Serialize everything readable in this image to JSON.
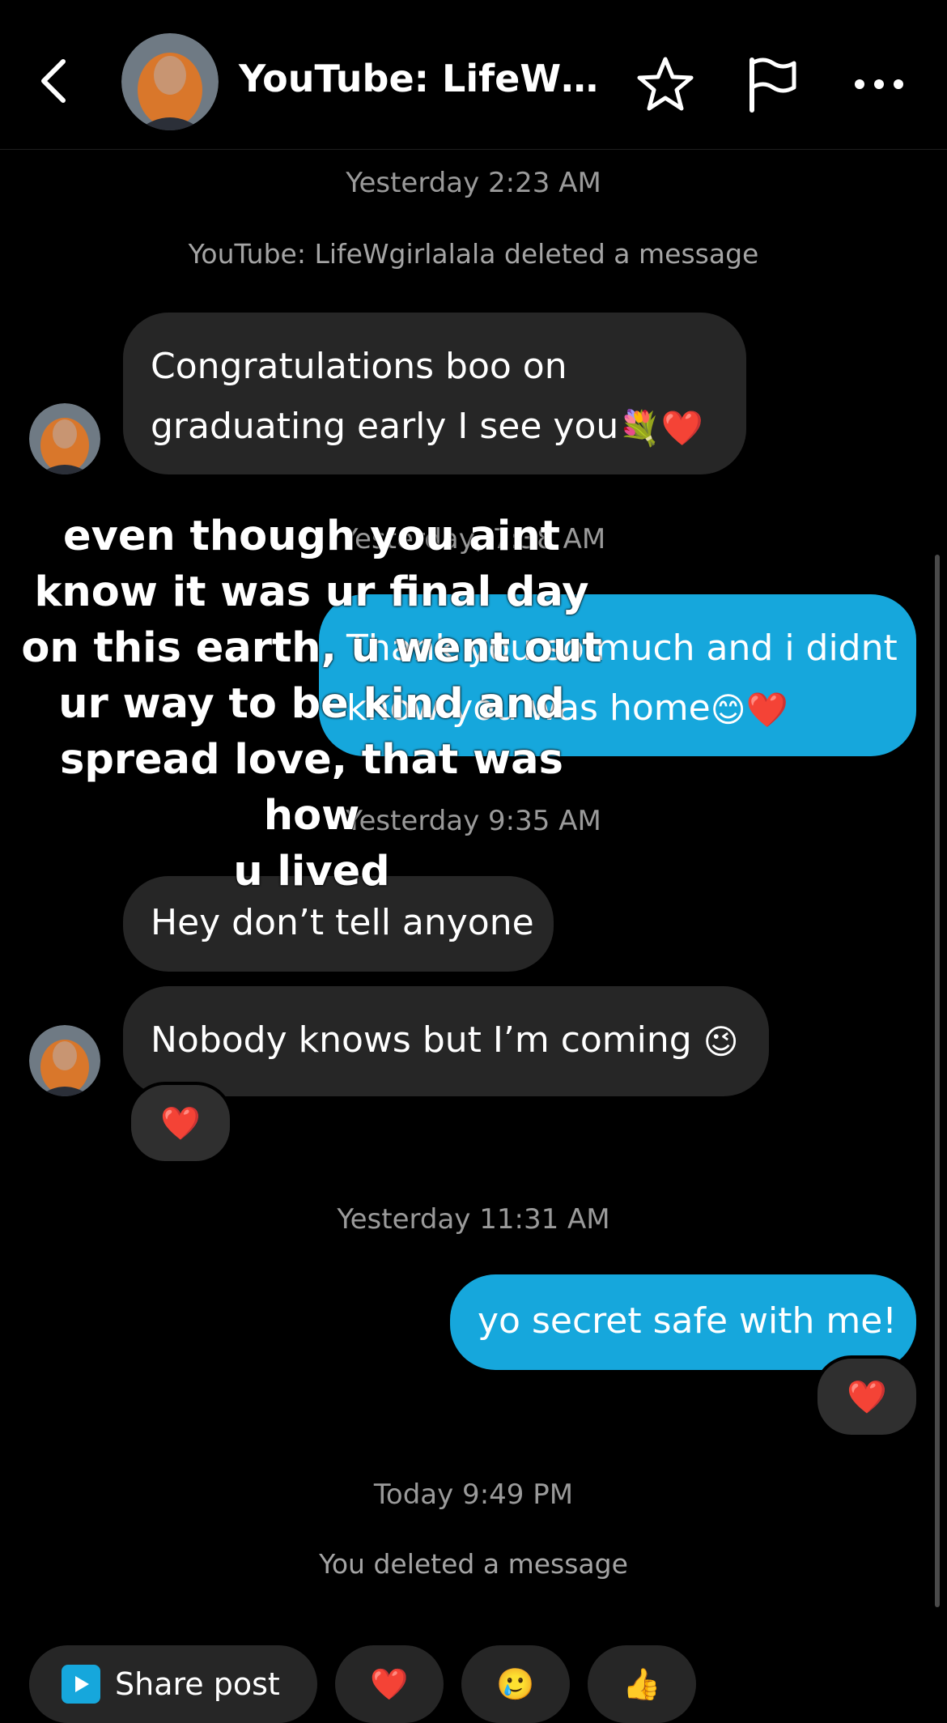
{
  "header": {
    "title": "YouTube: LifeW…",
    "icons": {
      "back": "back-chevron-icon",
      "star": "star-icon",
      "flag": "flag-icon",
      "more": "more-icon"
    }
  },
  "thread": {
    "ts_1": "Yesterday 2:23 AM",
    "sys_1": "YouTube: LifeWgirlalala deleted a message",
    "msg_1": "Congratulations boo on\ngraduating early I see you",
    "msg_1_emoji": "💐❤️",
    "ts_2": "Yesterday, 7:38 AM",
    "msg_2": "Thank you so much and i didnt\nknow you was home",
    "msg_2_emoji": "😊❤️",
    "ts_3": "Yesterday 9:35 AM",
    "msg_3": "Hey don’t tell anyone",
    "msg_4": "Nobody knows but I’m coming",
    "msg_4_emoji": "😉",
    "msg_4_reaction": "❤️",
    "ts_4": "Yesterday 11:31 AM",
    "msg_5": "yo secret safe with me!",
    "msg_5_reaction": "❤️",
    "ts_5": "Today 9:49 PM",
    "sys_2": "You deleted a message"
  },
  "overlay_caption": "even though you aint\nknow it was ur final day\non this earth, u went out\nur way to be kind and\nspread love, that was how\nu lived",
  "quick_actions": {
    "share_post": "Share post",
    "heart": "❤️",
    "blush": "🥲",
    "thumbs": "👍"
  },
  "colors": {
    "background": "#000000",
    "incoming_bubble": "#262626",
    "outgoing_bubble": "#16a7dc",
    "timestamp": "#9a9a9a"
  }
}
